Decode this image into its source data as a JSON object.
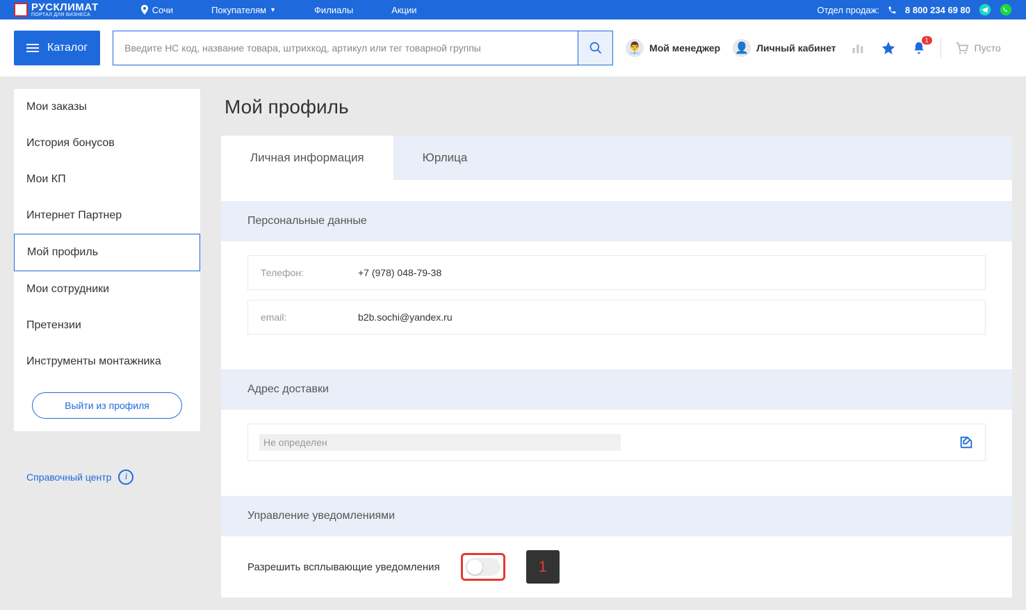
{
  "brand": {
    "name": "РУСКЛИМАТ",
    "tagline": "ПОРТАЛ ДЛЯ БИЗНЕСА"
  },
  "topbar": {
    "city": "Сочи",
    "links": {
      "buyers": "Покупателям",
      "branches": "Филиалы",
      "promo": "Акции"
    },
    "sales_label": "Отдел продаж:",
    "phone": "8 800 234 69 80"
  },
  "header": {
    "catalog": "Каталог",
    "search_placeholder": "Введите НС код, название товара, штрихкод, артикул или тег товарной группы",
    "manager": "Мой менеджер",
    "cabinet": "Личный кабинет",
    "notif_badge": "1",
    "cart": "Пусто"
  },
  "sidebar": {
    "items": [
      "Мои заказы",
      "История бонусов",
      "Мои КП",
      "Интернет Партнер",
      "Мой профиль",
      "Мои сотрудники",
      "Претензии",
      "Инструменты монтажника"
    ],
    "logout": "Выйти из профиля",
    "help": "Справочный центр"
  },
  "profile": {
    "title": "Мой профиль",
    "tabs": {
      "personal": "Личная информация",
      "legal": "Юрлица"
    },
    "personal_header": "Персональные данные",
    "phone_label": "Телефон:",
    "phone_value": "+7 (978) 048-79-38",
    "email_label": "email:",
    "email_value": "b2b.sochi@yandex.ru",
    "address_header": "Адрес доставки",
    "address_value": "Не определен",
    "notif_header": "Управление уведомлениями",
    "notif_label": "Разрешить всплывающие уведомления",
    "marker": "1"
  }
}
